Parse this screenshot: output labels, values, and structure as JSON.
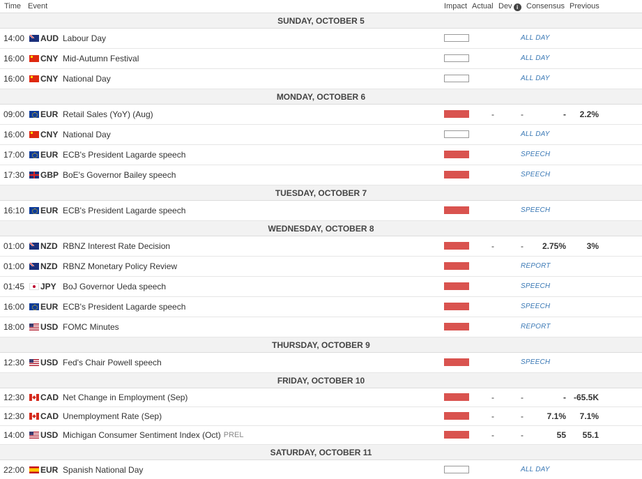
{
  "header": {
    "time": "Time",
    "event": "Event",
    "impact": "Impact",
    "actual": "Actual",
    "dev": "Dev",
    "consensus": "Consensus",
    "previous": "Previous"
  },
  "colors": {
    "high_impact": "#d9534f",
    "tag_text": "#3a78b5",
    "day_row_bg": "#f2f2f2"
  },
  "days": [
    {
      "label": "SUNDAY, OCTOBER 5",
      "events": [
        {
          "time": "14:00",
          "flag": "au",
          "currency": "AUD",
          "event": "Labour Day",
          "impact": "low",
          "tag": "ALL DAY"
        },
        {
          "time": "16:00",
          "flag": "cn",
          "currency": "CNY",
          "event": "Mid-Autumn Festival",
          "impact": "low",
          "tag": "ALL DAY"
        },
        {
          "time": "16:00",
          "flag": "cn",
          "currency": "CNY",
          "event": "National Day",
          "impact": "low",
          "tag": "ALL DAY"
        }
      ]
    },
    {
      "label": "MONDAY, OCTOBER 6",
      "events": [
        {
          "time": "09:00",
          "flag": "eu",
          "currency": "EUR",
          "event": "Retail Sales (YoY) (Aug)",
          "impact": "high",
          "actual": "-",
          "dev": "-",
          "consensus": "-",
          "previous": "2.2%"
        },
        {
          "time": "16:00",
          "flag": "cn",
          "currency": "CNY",
          "event": "National Day",
          "impact": "low",
          "tag": "ALL DAY"
        },
        {
          "time": "17:00",
          "flag": "eu",
          "currency": "EUR",
          "event": "ECB's President Lagarde speech",
          "impact": "high",
          "tag": "SPEECH"
        },
        {
          "time": "17:30",
          "flag": "gb",
          "currency": "GBP",
          "event": "BoE's Governor Bailey speech",
          "impact": "high",
          "tag": "SPEECH"
        }
      ]
    },
    {
      "label": "TUESDAY, OCTOBER 7",
      "events": [
        {
          "time": "16:10",
          "flag": "eu",
          "currency": "EUR",
          "event": "ECB's President Lagarde speech",
          "impact": "high",
          "tag": "SPEECH"
        }
      ]
    },
    {
      "label": "WEDNESDAY, OCTOBER 8",
      "events": [
        {
          "time": "01:00",
          "flag": "nz",
          "currency": "NZD",
          "event": "RBNZ Interest Rate Decision",
          "impact": "high",
          "actual": "-",
          "dev": "-",
          "consensus": "2.75%",
          "previous": "3%"
        },
        {
          "time": "01:00",
          "flag": "nz",
          "currency": "NZD",
          "event": "RBNZ Monetary Policy Review",
          "impact": "high",
          "tag": "REPORT"
        },
        {
          "time": "01:45",
          "flag": "jp",
          "currency": "JPY",
          "event": "BoJ Governor Ueda speech",
          "impact": "high",
          "tag": "SPEECH"
        },
        {
          "time": "16:00",
          "flag": "eu",
          "currency": "EUR",
          "event": "ECB's President Lagarde speech",
          "impact": "high",
          "tag": "SPEECH"
        },
        {
          "time": "18:00",
          "flag": "us",
          "currency": "USD",
          "event": "FOMC Minutes",
          "impact": "high",
          "tag": "REPORT"
        }
      ]
    },
    {
      "label": "THURSDAY, OCTOBER 9",
      "events": [
        {
          "time": "12:30",
          "flag": "us",
          "currency": "USD",
          "event": "Fed's Chair Powell speech",
          "impact": "high",
          "tag": "SPEECH"
        }
      ]
    },
    {
      "label": "FRIDAY, OCTOBER 10",
      "events": [
        {
          "time": "12:30",
          "flag": "ca",
          "currency": "CAD",
          "event": "Net Change in Employment (Sep)",
          "impact": "high",
          "actual": "-",
          "dev": "-",
          "consensus": "-",
          "previous": "-65.5K"
        },
        {
          "time": "12:30",
          "flag": "ca",
          "currency": "CAD",
          "event": "Unemployment Rate (Sep)",
          "impact": "high",
          "actual": "-",
          "dev": "-",
          "consensus": "7.1%",
          "previous": "7.1%"
        },
        {
          "time": "14:00",
          "flag": "us",
          "currency": "USD",
          "event": "Michigan Consumer Sentiment Index (Oct)",
          "prel": "PREL",
          "impact": "high",
          "actual": "-",
          "dev": "-",
          "consensus": "55",
          "previous": "55.1"
        }
      ]
    },
    {
      "label": "SATURDAY, OCTOBER 11",
      "events": [
        {
          "time": "22:00",
          "flag": "es",
          "currency": "EUR",
          "event": "Spanish National Day",
          "impact": "low",
          "tag": "ALL DAY"
        }
      ]
    }
  ]
}
